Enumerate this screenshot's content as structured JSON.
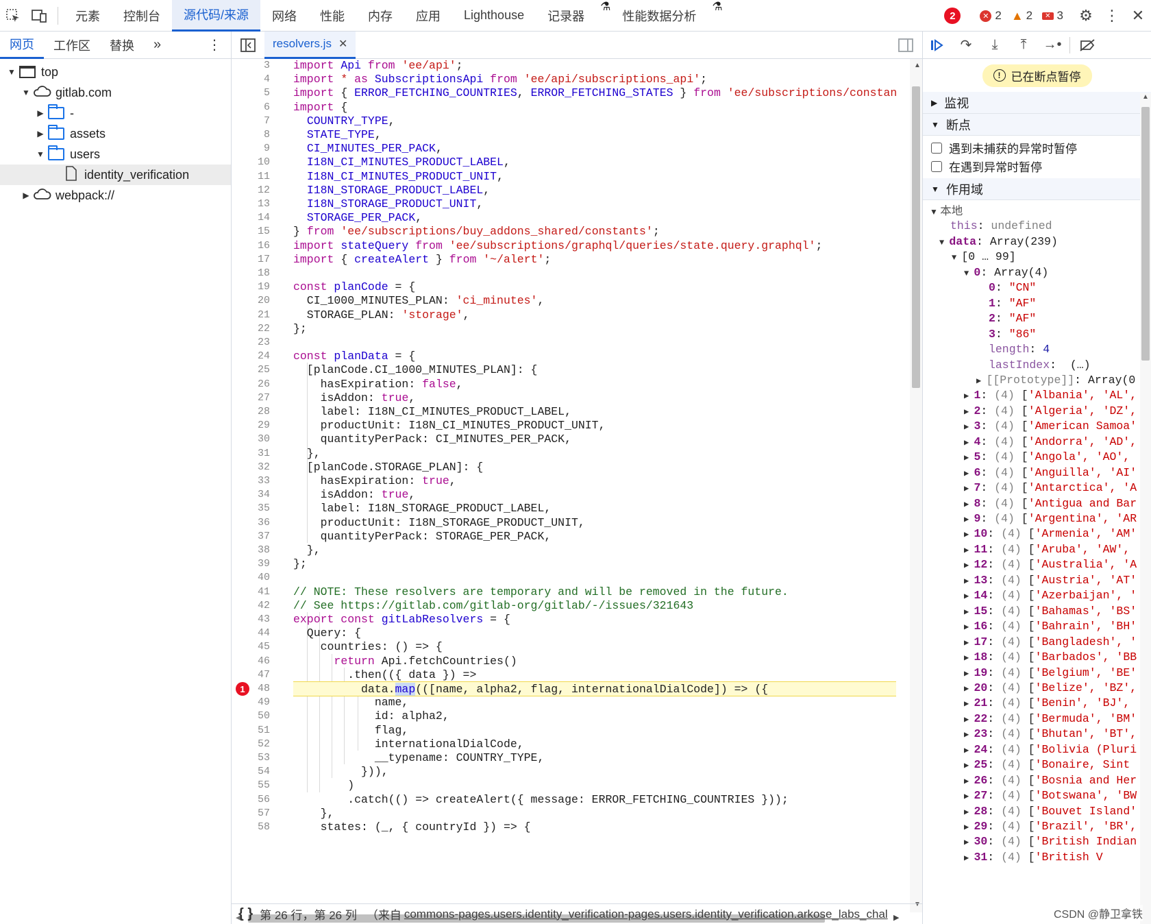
{
  "topbar": {
    "tabs": [
      "元素",
      "控制台",
      "源代码/来源",
      "网络",
      "性能",
      "内存",
      "应用",
      "Lighthouse",
      "记录器",
      "性能数据分析"
    ],
    "active_tab": "源代码/来源",
    "errors": "2",
    "warnings": "2",
    "issues": "3",
    "annotation_badge": "2"
  },
  "left": {
    "tabs": [
      "网页",
      "工作区",
      "替换"
    ],
    "tree": [
      {
        "label": "top",
        "depth": 0,
        "kind": "frame",
        "open": true
      },
      {
        "label": "gitlab.com",
        "depth": 1,
        "kind": "cloud",
        "open": true
      },
      {
        "label": "-",
        "depth": 2,
        "kind": "folder",
        "open": false
      },
      {
        "label": "assets",
        "depth": 2,
        "kind": "folder",
        "open": false
      },
      {
        "label": "users",
        "depth": 2,
        "kind": "folder",
        "open": true
      },
      {
        "label": "identity_verification",
        "depth": 3,
        "kind": "file",
        "selected": true
      },
      {
        "label": "webpack://",
        "depth": 1,
        "kind": "cloud",
        "open": false
      }
    ]
  },
  "editor": {
    "file_tab": "resolvers.js",
    "breakpoint_line": "48",
    "breakpoint_badge": "1",
    "first_line": 3,
    "lines": [
      [
        [
          "k",
          "import "
        ],
        [
          "d",
          "Api "
        ],
        [
          "k",
          "from "
        ],
        [
          "s",
          "'ee/api'"
        ],
        [
          "p",
          ";"
        ]
      ],
      [
        [
          "k",
          "import "
        ],
        [
          "s",
          "* "
        ],
        [
          "k",
          "as "
        ],
        [
          "d",
          "SubscriptionsApi "
        ],
        [
          "k",
          "from "
        ],
        [
          "s",
          "'ee/api/subscriptions_api'"
        ],
        [
          "p",
          ";"
        ]
      ],
      [
        [
          "k",
          "import "
        ],
        [
          "p",
          "{ "
        ],
        [
          "d",
          "ERROR_FETCHING_COUNTRIES"
        ],
        [
          "p",
          ", "
        ],
        [
          "d",
          "ERROR_FETCHING_STATES"
        ],
        [
          "p",
          " } "
        ],
        [
          "k",
          "from "
        ],
        [
          "s",
          "'ee/subscriptions/constant"
        ]
      ],
      [
        [
          "k",
          "import "
        ],
        [
          "p",
          "{"
        ]
      ],
      [
        [
          "p",
          "  "
        ],
        [
          "d",
          "COUNTRY_TYPE"
        ],
        [
          "p",
          ","
        ]
      ],
      [
        [
          "p",
          "  "
        ],
        [
          "d",
          "STATE_TYPE"
        ],
        [
          "p",
          ","
        ]
      ],
      [
        [
          "p",
          "  "
        ],
        [
          "d",
          "CI_MINUTES_PER_PACK"
        ],
        [
          "p",
          ","
        ]
      ],
      [
        [
          "p",
          "  "
        ],
        [
          "d",
          "I18N_CI_MINUTES_PRODUCT_LABEL"
        ],
        [
          "p",
          ","
        ]
      ],
      [
        [
          "p",
          "  "
        ],
        [
          "d",
          "I18N_CI_MINUTES_PRODUCT_UNIT"
        ],
        [
          "p",
          ","
        ]
      ],
      [
        [
          "p",
          "  "
        ],
        [
          "d",
          "I18N_STORAGE_PRODUCT_LABEL"
        ],
        [
          "p",
          ","
        ]
      ],
      [
        [
          "p",
          "  "
        ],
        [
          "d",
          "I18N_STORAGE_PRODUCT_UNIT"
        ],
        [
          "p",
          ","
        ]
      ],
      [
        [
          "p",
          "  "
        ],
        [
          "d",
          "STORAGE_PER_PACK"
        ],
        [
          "p",
          ","
        ]
      ],
      [
        [
          "p",
          "} "
        ],
        [
          "k",
          "from "
        ],
        [
          "s",
          "'ee/subscriptions/buy_addons_shared/constants'"
        ],
        [
          "p",
          ";"
        ]
      ],
      [
        [
          "k",
          "import "
        ],
        [
          "d",
          "stateQuery "
        ],
        [
          "k",
          "from "
        ],
        [
          "s",
          "'ee/subscriptions/graphql/queries/state.query.graphql'"
        ],
        [
          "p",
          ";"
        ]
      ],
      [
        [
          "k",
          "import "
        ],
        [
          "p",
          "{ "
        ],
        [
          "d",
          "createAlert"
        ],
        [
          "p",
          " } "
        ],
        [
          "k",
          "from "
        ],
        [
          "s",
          "'~/alert'"
        ],
        [
          "p",
          ";"
        ]
      ],
      [
        [
          "p",
          ""
        ]
      ],
      [
        [
          "k",
          "const "
        ],
        [
          "d",
          "planCode"
        ],
        [
          "p",
          " = {"
        ]
      ],
      [
        [
          "p",
          "  CI_1000_MINUTES_PLAN: "
        ],
        [
          "s",
          "'ci_minutes'"
        ],
        [
          "p",
          ","
        ]
      ],
      [
        [
          "p",
          "  STORAGE_PLAN: "
        ],
        [
          "s",
          "'storage'"
        ],
        [
          "p",
          ","
        ]
      ],
      [
        [
          "p",
          "};"
        ]
      ],
      [
        [
          "p",
          ""
        ]
      ],
      [
        [
          "k",
          "const "
        ],
        [
          "d",
          "planData"
        ],
        [
          "p",
          " = {"
        ]
      ],
      [
        [
          "p",
          "  [planCode.CI_1000_MINUTES_PLAN]: {"
        ]
      ],
      [
        [
          "p",
          "    hasExpiration: "
        ],
        [
          "k",
          "false"
        ],
        [
          "p",
          ","
        ]
      ],
      [
        [
          "p",
          "    isAddon: "
        ],
        [
          "k",
          "true"
        ],
        [
          "p",
          ","
        ]
      ],
      [
        [
          "p",
          "    label: I18N_CI_MINUTES_PRODUCT_LABEL,"
        ]
      ],
      [
        [
          "p",
          "    productUnit: I18N_CI_MINUTES_PRODUCT_UNIT,"
        ]
      ],
      [
        [
          "p",
          "    quantityPerPack: CI_MINUTES_PER_PACK,"
        ]
      ],
      [
        [
          "p",
          "  },"
        ]
      ],
      [
        [
          "p",
          "  [planCode.STORAGE_PLAN]: {"
        ]
      ],
      [
        [
          "p",
          "    hasExpiration: "
        ],
        [
          "k",
          "true"
        ],
        [
          "p",
          ","
        ]
      ],
      [
        [
          "p",
          "    isAddon: "
        ],
        [
          "k",
          "true"
        ],
        [
          "p",
          ","
        ]
      ],
      [
        [
          "p",
          "    label: I18N_STORAGE_PRODUCT_LABEL,"
        ]
      ],
      [
        [
          "p",
          "    productUnit: I18N_STORAGE_PRODUCT_UNIT,"
        ]
      ],
      [
        [
          "p",
          "    quantityPerPack: STORAGE_PER_PACK,"
        ]
      ],
      [
        [
          "p",
          "  },"
        ]
      ],
      [
        [
          "p",
          "};"
        ]
      ],
      [
        [
          "p",
          ""
        ]
      ],
      [
        [
          "c",
          "// NOTE: These resolvers are temporary and will be removed in the future."
        ]
      ],
      [
        [
          "c",
          "// See https://gitlab.com/gitlab-org/gitlab/-/issues/321643"
        ]
      ],
      [
        [
          "k",
          "export const "
        ],
        [
          "d",
          "gitLabResolvers"
        ],
        [
          "p",
          " = {"
        ]
      ],
      [
        [
          "p",
          "  Query: {"
        ]
      ],
      [
        [
          "p",
          "    countries: () => {"
        ]
      ],
      [
        [
          "p",
          "      "
        ],
        [
          "k",
          "return "
        ],
        [
          "p",
          "Api.fetchCountries()"
        ]
      ],
      [
        [
          "p",
          "        .then(({ data }) =>"
        ]
      ],
      [
        [
          "p",
          "          data."
        ],
        [
          "h",
          "map"
        ],
        [
          "p",
          "(([name, alpha2, flag, internationalDialCode]) => ({"
        ]
      ],
      [
        [
          "p",
          "            name,"
        ]
      ],
      [
        [
          "p",
          "            id: alpha2,"
        ]
      ],
      [
        [
          "p",
          "            flag,"
        ]
      ],
      [
        [
          "p",
          "            internationalDialCode,"
        ]
      ],
      [
        [
          "p",
          "            __typename: COUNTRY_TYPE,"
        ]
      ],
      [
        [
          "p",
          "          })),"
        ]
      ],
      [
        [
          "p",
          "        )"
        ]
      ],
      [
        [
          "p",
          "        .catch(() => createAlert({ message: ERROR_FETCHING_COUNTRIES }));"
        ]
      ],
      [
        [
          "p",
          "    },"
        ]
      ],
      [
        [
          "p",
          "    states: (_, { countryId }) => {"
        ]
      ]
    ]
  },
  "status_bar": {
    "position": "第 26 行，第 26 列",
    "source_prefix": "（来自",
    "source_link": "commons-pages.users.identity_verification-pages.users.identity_verification.arkose_labs_chal"
  },
  "debugger": {
    "paused_text": "已在断点暂停",
    "sections": {
      "watch": "监视",
      "breakpoints": "断点",
      "scope": "作用域"
    },
    "checkboxes": [
      "遇到未捕获的异常时暂停",
      "在遇到异常时暂停"
    ],
    "local_label": "本地",
    "scope_this": {
      "key": "this",
      "value": "undefined"
    },
    "scope_data": {
      "key": "data",
      "value": "Array(239)"
    },
    "range_label": "[0 … 99]",
    "item0": {
      "key": "0",
      "value": "Array(4)"
    },
    "item0_values": [
      [
        "0",
        "\"CN\""
      ],
      [
        "1",
        "\"AF\""
      ],
      [
        "2",
        "\"AF\""
      ],
      [
        "3",
        "\"86\""
      ]
    ],
    "item0_length": {
      "key": "length",
      "value": "4"
    },
    "item0_lastIndex": {
      "key": "lastIndex",
      "value": "(…)"
    },
    "item0_proto": {
      "key": "[[Prototype]]",
      "value": "Array(0"
    },
    "countries": [
      [
        "1",
        "'Albania', 'AL',"
      ],
      [
        "2",
        "'Algeria', 'DZ',"
      ],
      [
        "3",
        "'American Samoa'"
      ],
      [
        "4",
        "'Andorra', 'AD',"
      ],
      [
        "5",
        "'Angola', 'AO',"
      ],
      [
        "6",
        "'Anguilla', 'AI'"
      ],
      [
        "7",
        "'Antarctica', 'A"
      ],
      [
        "8",
        "'Antigua and Bar"
      ],
      [
        "9",
        "'Argentina', 'AR"
      ],
      [
        "10",
        "'Armenia', 'AM'"
      ],
      [
        "11",
        "'Aruba', 'AW',"
      ],
      [
        "12",
        "'Australia', 'A"
      ],
      [
        "13",
        "'Austria', 'AT'"
      ],
      [
        "14",
        "'Azerbaijan', '"
      ],
      [
        "15",
        "'Bahamas', 'BS'"
      ],
      [
        "16",
        "'Bahrain', 'BH'"
      ],
      [
        "17",
        "'Bangladesh', '"
      ],
      [
        "18",
        "'Barbados', 'BB"
      ],
      [
        "19",
        "'Belgium', 'BE'"
      ],
      [
        "20",
        "'Belize', 'BZ',"
      ],
      [
        "21",
        "'Benin', 'BJ',"
      ],
      [
        "22",
        "'Bermuda', 'BM'"
      ],
      [
        "23",
        "'Bhutan', 'BT',"
      ],
      [
        "24",
        "'Bolivia (Pluri"
      ],
      [
        "25",
        "'Bonaire, Sint"
      ],
      [
        "26",
        "'Bosnia and Her"
      ],
      [
        "27",
        "'Botswana', 'BW"
      ],
      [
        "28",
        "'Bouvet Island'"
      ],
      [
        "29",
        "'Brazil', 'BR',"
      ],
      [
        "30",
        "'British Indian"
      ],
      [
        "31",
        "'British V"
      ]
    ],
    "count_prefix": "(4)",
    "watermark": "CSDN @静卫拿铁"
  }
}
